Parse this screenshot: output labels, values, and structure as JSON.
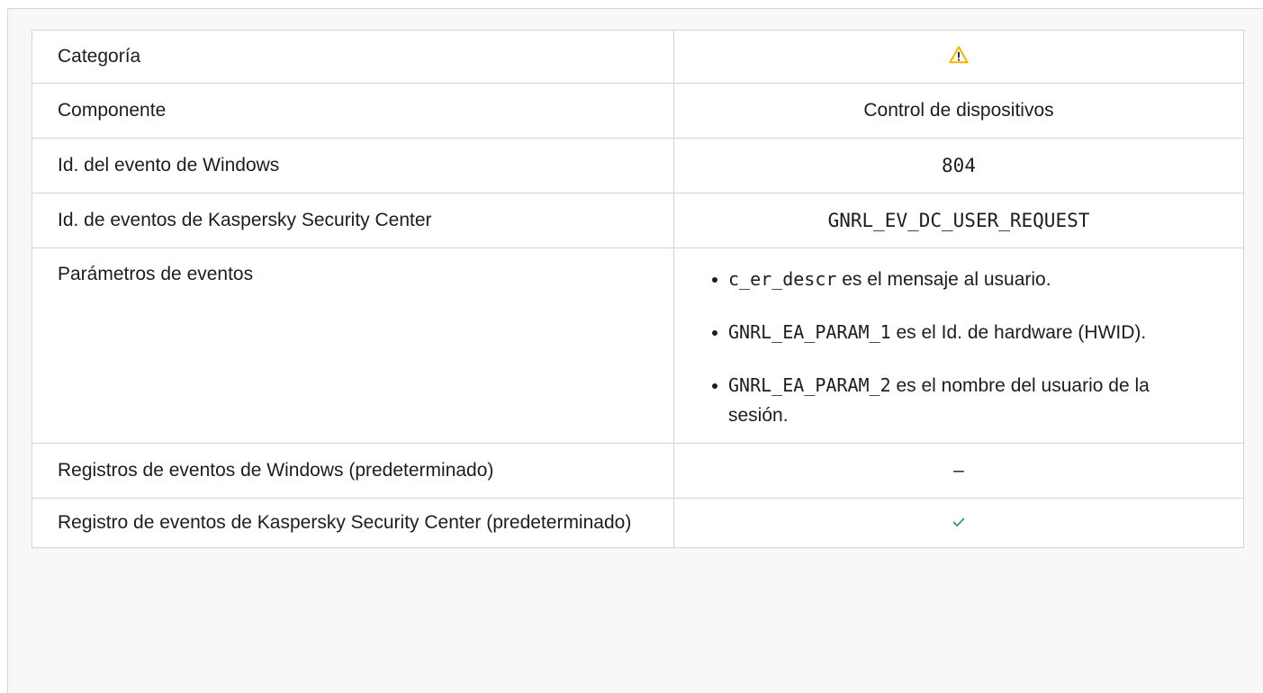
{
  "colors": {
    "warning": "#f2b600",
    "check": "#2e9c7e",
    "border": "#d3d3d3"
  },
  "rows": {
    "category": {
      "label": "Categoría",
      "icon": "warning-icon"
    },
    "component": {
      "label": "Componente",
      "value": "Control de dispositivos"
    },
    "windows_event_id": {
      "label": "Id. del evento de Windows",
      "value": "804"
    },
    "ksc_event_id": {
      "label": "Id. de eventos de Kaspersky Security Center",
      "value": "GNRL_EV_DC_USER_REQUEST"
    },
    "event_params": {
      "label": "Parámetros de eventos",
      "items": [
        {
          "code": "c_er_descr",
          "text": " es el mensaje al usuario."
        },
        {
          "code": "GNRL_EA_PARAM_1",
          "text": " es el Id. de hardware (HWID)."
        },
        {
          "code": "GNRL_EA_PARAM_2",
          "text": " es el nombre del usuario de la sesión."
        }
      ]
    },
    "windows_log": {
      "label": "Registros de eventos de Windows (predeterminado)",
      "value": "–"
    },
    "ksc_log": {
      "label": "Registro de eventos de Kaspersky Security Center (predeterminado)",
      "icon": "check-icon"
    }
  }
}
